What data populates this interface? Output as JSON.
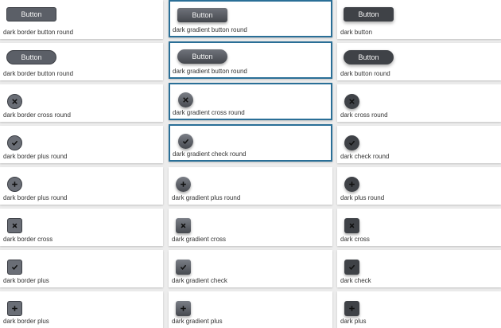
{
  "button_label": "Button",
  "cards": [
    {
      "id": "c0",
      "label": "dark border button round"
    },
    {
      "id": "c1",
      "label": "dark gradient button round"
    },
    {
      "id": "c2",
      "label": "dark button"
    },
    {
      "id": "c3",
      "label": "dark border button round"
    },
    {
      "id": "c4",
      "label": "dark gradient button round"
    },
    {
      "id": "c5",
      "label": "dark button round"
    },
    {
      "id": "c6",
      "label": "dark border cross round"
    },
    {
      "id": "c7",
      "label": "dark gradient cross round"
    },
    {
      "id": "c8",
      "label": "dark cross round"
    },
    {
      "id": "c9",
      "label": "dark border plus round"
    },
    {
      "id": "c10",
      "label": "dark gradient check round"
    },
    {
      "id": "c11",
      "label": "dark check round"
    },
    {
      "id": "c12",
      "label": "dark border plus round"
    },
    {
      "id": "c13",
      "label": "dark gradient plus round"
    },
    {
      "id": "c14",
      "label": "dark plus round"
    },
    {
      "id": "c15",
      "label": "dark border cross"
    },
    {
      "id": "c16",
      "label": "dark gradient cross"
    },
    {
      "id": "c17",
      "label": "dark cross"
    },
    {
      "id": "c18",
      "label": "dark border plus"
    },
    {
      "id": "c19",
      "label": "dark gradient check"
    },
    {
      "id": "c20",
      "label": "dark check"
    },
    {
      "id": "c21",
      "label": "dark border plus"
    },
    {
      "id": "c22",
      "label": "dark gradient plus"
    },
    {
      "id": "c23",
      "label": "dark plus"
    }
  ],
  "colors": {
    "selected_border": "#2a6f97",
    "dark_fill": "#3f4247",
    "border_fill": "#6a6e76"
  }
}
